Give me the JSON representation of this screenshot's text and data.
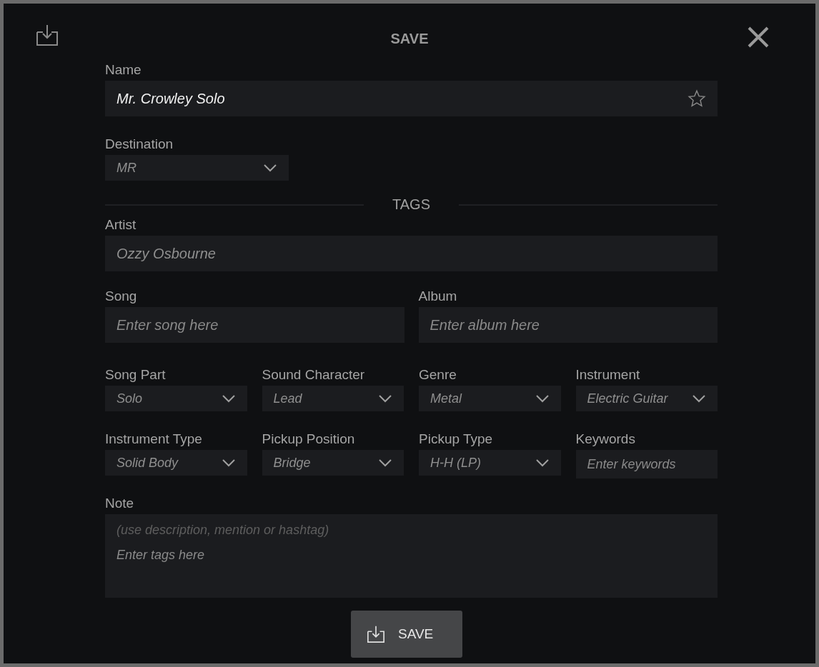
{
  "dialog": {
    "title": "SAVE"
  },
  "name": {
    "label": "Name",
    "value": "Mr. Crowley Solo",
    "favorite": false
  },
  "destination": {
    "label": "Destination",
    "value": "MR"
  },
  "tags_heading": "TAGS",
  "artist": {
    "label": "Artist",
    "value": "Ozzy Osbourne"
  },
  "song": {
    "label": "Song",
    "placeholder": "Enter song here"
  },
  "album": {
    "label": "Album",
    "placeholder": "Enter album here"
  },
  "fields": [
    {
      "kind": "select",
      "label": "Song Part",
      "value": "Solo"
    },
    {
      "kind": "select",
      "label": "Sound Character",
      "value": "Lead"
    },
    {
      "kind": "select",
      "label": "Genre",
      "value": "Metal"
    },
    {
      "kind": "select",
      "label": "Instrument",
      "value": "Electric Guitar"
    },
    {
      "kind": "select",
      "label": "Instrument Type",
      "value": "Solid Body"
    },
    {
      "kind": "select",
      "label": "Pickup Position",
      "value": "Bridge"
    },
    {
      "kind": "select",
      "label": "Pickup Type",
      "value": "H-H (LP)"
    },
    {
      "kind": "text",
      "label": "Keywords",
      "placeholder": "Enter keywords"
    }
  ],
  "note": {
    "label": "Note",
    "hint": "(use description, mention or hashtag)",
    "placeholder": "Enter tags here"
  },
  "save_button": {
    "label": "SAVE"
  }
}
